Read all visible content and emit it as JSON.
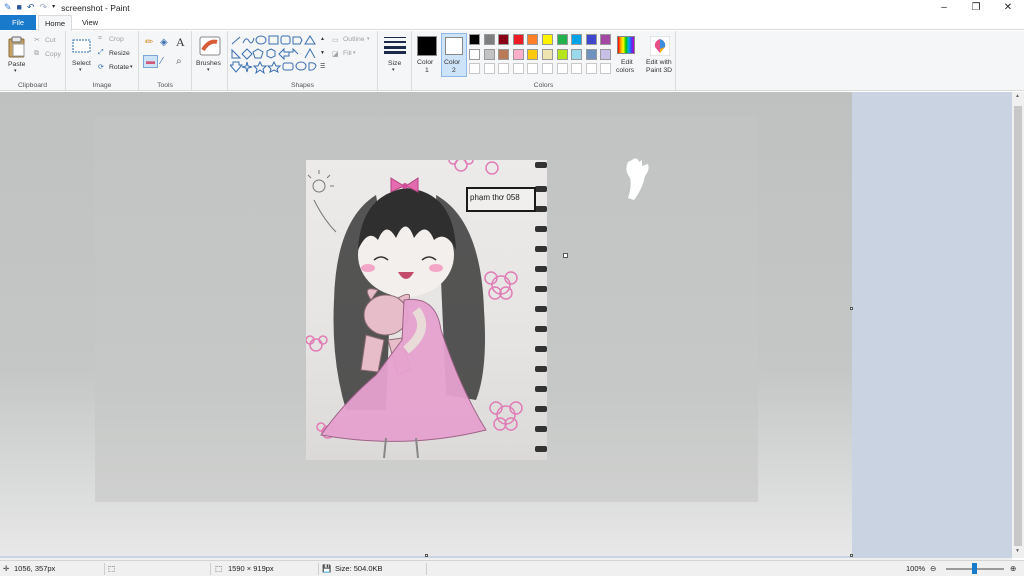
{
  "window": {
    "title": "screenshot - Paint",
    "controls": [
      "minimize-icon",
      "restore-icon",
      "close-icon"
    ]
  },
  "tabs": [
    {
      "label": "File"
    },
    {
      "label": "Home"
    },
    {
      "label": "View"
    }
  ],
  "ribbon": {
    "clipboard": {
      "group_label": "Clipboard",
      "paste": "Paste",
      "cut": "Cut",
      "copy": "Copy"
    },
    "image": {
      "group_label": "Image",
      "select": "Select",
      "crop": "Crop",
      "resize": "Resize",
      "rotate": "Rotate"
    },
    "tools": {
      "group_label": "Tools"
    },
    "brushes": {
      "label": "Brushes"
    },
    "shapes": {
      "group_label": "Shapes",
      "outline": "Outline",
      "fill": "Fill"
    },
    "size": {
      "label": "Size"
    },
    "colors": {
      "group_label": "Colors",
      "color1_label": "Color",
      "color1_num": "1",
      "color2_label": "Color",
      "color2_num": "2",
      "edit_colors_1": "Edit",
      "edit_colors_2": "colors",
      "paint3d_1": "Edit with",
      "paint3d_2": "Paint 3D",
      "color1_value": "#000000",
      "color2_value": "#ffffff",
      "palette_row1": [
        "#000000",
        "#7f7f7f",
        "#880015",
        "#ed1c24",
        "#ff7f27",
        "#fff200",
        "#22b14c",
        "#00a2e8",
        "#3f48cc",
        "#a349a4"
      ],
      "palette_row2": [
        "#ffffff",
        "#c3c3c3",
        "#b97a57",
        "#ffaec9",
        "#ffc90e",
        "#efe4b0",
        "#b5e61d",
        "#99d9ea",
        "#7092be",
        "#c8bfe7"
      ]
    }
  },
  "canvas": {
    "textbox_text": "phạm thơ 058"
  },
  "status": {
    "cursor_pos": "1056, 357px",
    "canvas_size": "1590 × 919px",
    "file_size": "Size: 504.0KB",
    "zoom": "100%"
  }
}
